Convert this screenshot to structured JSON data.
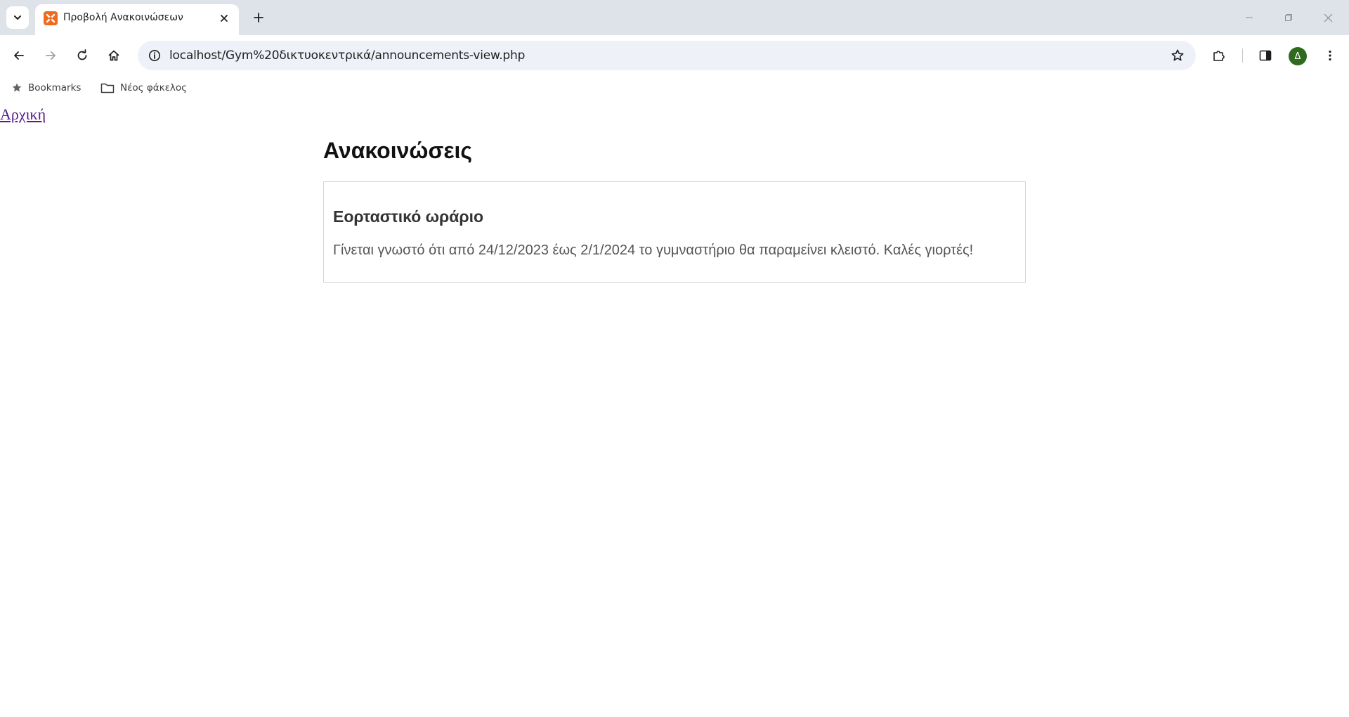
{
  "browser": {
    "tab_title": "Προβολή Ανακοινώσεων",
    "url": "localhost/Gym%20δικτυοκεντρικά/announcements-view.php",
    "profile_initial": "Δ"
  },
  "bookmarks_bar": {
    "items": [
      {
        "label": "Bookmarks",
        "icon": "star-icon"
      },
      {
        "label": "Νέος φάκελος",
        "icon": "folder-icon"
      }
    ]
  },
  "page": {
    "home_link": "Αρχική",
    "heading": "Ανακοινώσεις",
    "announcements": [
      {
        "title": "Εορταστικό ωράριο",
        "body": "Γίνεται γνωστό ότι από 24/12/2023 έως 2/1/2024 το γυμναστήριο θα παραμείνει κλειστό. Καλές γιορτές!"
      }
    ]
  },
  "colors": {
    "tabstrip_bg": "#dee3ea",
    "omnibox_bg": "#eef1f7",
    "favicon": "#f06a1e",
    "avatar": "#2e6b1e",
    "visited_link": "#551a8b"
  }
}
